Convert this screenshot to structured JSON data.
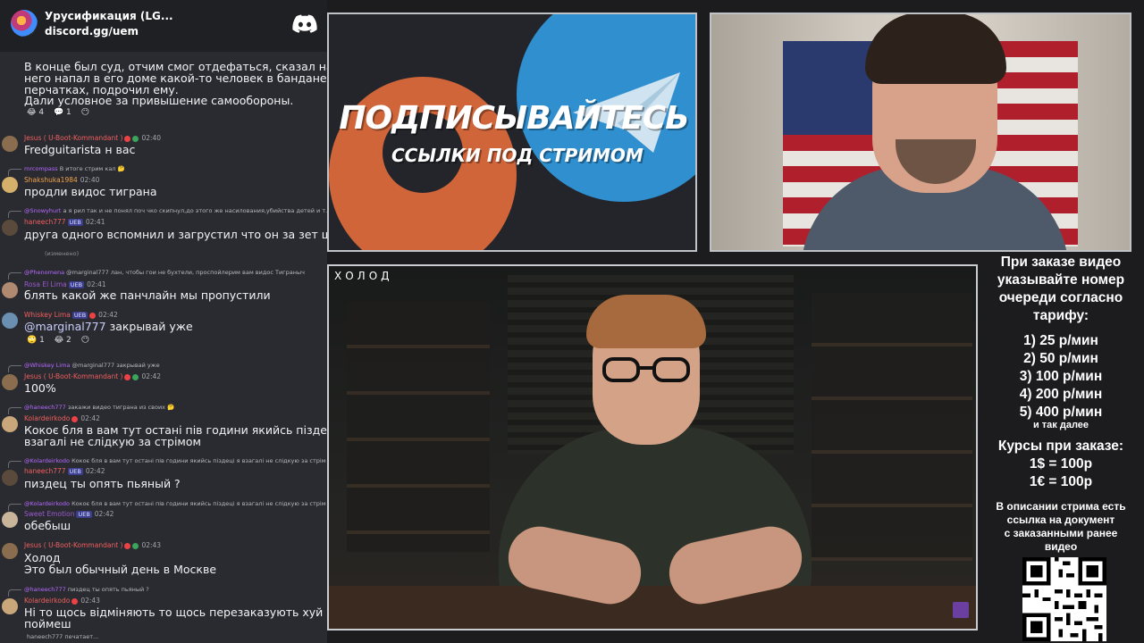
{
  "discord": {
    "server_name": "Урусификация (LG...",
    "server_link": "discord.gg/uem"
  },
  "messages": {
    "m0": {
      "lines": [
        "В конце был суд, отчим смог отдефаться, сказал на",
        "него напал в его доме какой-то человек в бандане и",
        "перчатках, подрочил ему.",
        "Дали условное за привышение самообороны."
      ],
      "reactions": [
        "😂 4",
        "💬 1",
        "😶"
      ]
    },
    "m1": {
      "user": "Jesus ( U-Boot-Kommandant )",
      "time": "02:40",
      "text": "Fredguitarista н вас"
    },
    "m2": {
      "reply_to": "mrcompass",
      "reply_text": "В итоге стрим кал 🤔",
      "user": "Shakshuka1984",
      "time": "02:40",
      "text": "продли видос тиграна"
    },
    "m3": {
      "reply_to": "@Snowyhurt",
      "reply_text": "а я рил так и не понял поч чко скипнул,до этого же насилования,убийства детей и т.д",
      "user": "haneech777",
      "badge": "UEB",
      "time": "02:41",
      "text": "друга одного вспомнил и загрустил что он за зет щас",
      "edited": "(изменено)"
    },
    "m4": {
      "reply_to": "@Phenomena",
      "reply_text": "@marginal777 лан, чтобы гои не бухтели, проспойлерим вам видос Тиграныч",
      "user": "Rosa El Lima",
      "badge": "UEB",
      "time": "02:41",
      "text": "блять какой же панчлайн мы пропустили"
    },
    "m5": {
      "user": "Whiskey Lima",
      "badge": "UEB",
      "time": "02:42",
      "mention": "@marginal777",
      "text": "закрывай уже",
      "reactions": [
        "🙄 1",
        "😂 2",
        "😶"
      ]
    },
    "m6": {
      "reply_to": "@Whiskey Lima",
      "reply_text": "@marginal777 закрывай уже",
      "user": "Jesus ( U-Boot-Kommandant )",
      "time": "02:42",
      "text": "100%"
    },
    "m7": {
      "reply_to": "@haneech777",
      "reply_text": "закажи видео тиграна из своих 🤔",
      "user": "Kolardeirkodo",
      "time": "02:42",
      "text": "Кокоє бля в вам тут остані пів години якийсь піздеці я",
      "text2": "взагалі не слідкую за стрімом"
    },
    "m8": {
      "reply_to": "@Kolardeirkodo",
      "reply_text": "Кокоє бля в вам тут остані пів години якийсь піздеці я взагалі не слідкую за стрім",
      "user": "haneech777",
      "badge": "UEB",
      "time": "02:42",
      "text": "пиздец ты опять пьяный ?"
    },
    "m9": {
      "reply_to": "@Kolardeirkodo",
      "reply_text": "Кокоє бля в вам тут остані пів години якийсь піздеці я взагалі не слідкую за стрім",
      "user": "Sweet Emotion",
      "badge": "UEB",
      "time": "02:42",
      "text": "обебыш"
    },
    "m10": {
      "user": "Jesus ( U-Boot-Kommandant )",
      "time": "02:43",
      "text": "Холод",
      "text2": "Это был обычный день в Москве"
    },
    "m11": {
      "reply_to": "@haneech777",
      "reply_text": "пиздец ты опять пьяный ?",
      "user": "Kolardeirkodo",
      "time": "02:43",
      "text": "Ні то щось відміняють то щось перезаказують хуй впс",
      "text2": "поймеш"
    },
    "typing": "haneech777 печатает..."
  },
  "promo": {
    "title": "ПОДПИСЫВАЙТЕСЬ",
    "subtitle": "ССЫЛКИ ПОД СТРИМОМ",
    "boosty_color": "#e06a3c",
    "telegram_color": "#2f8fcf"
  },
  "video": {
    "logo": "ХОЛОД"
  },
  "info": {
    "order": [
      "При заказе видео",
      "указывайте номер",
      "очереди согласно",
      "тарифу:"
    ],
    "prices": [
      "1) 25 р/мин",
      "2) 50 р/мин",
      "3) 100 р/мин",
      "4) 200 р/мин",
      "5) 400 р/мин"
    ],
    "etc": "и так далее",
    "rates": [
      "Курсы при заказе:",
      "1$ = 100р",
      "1€ = 100р"
    ],
    "desc": [
      "В описании стрима есть",
      "ссылка на документ",
      "с заказанными ранее",
      "видео"
    ]
  },
  "icons": {
    "discord": "discord-icon",
    "qr": "qr-code"
  }
}
